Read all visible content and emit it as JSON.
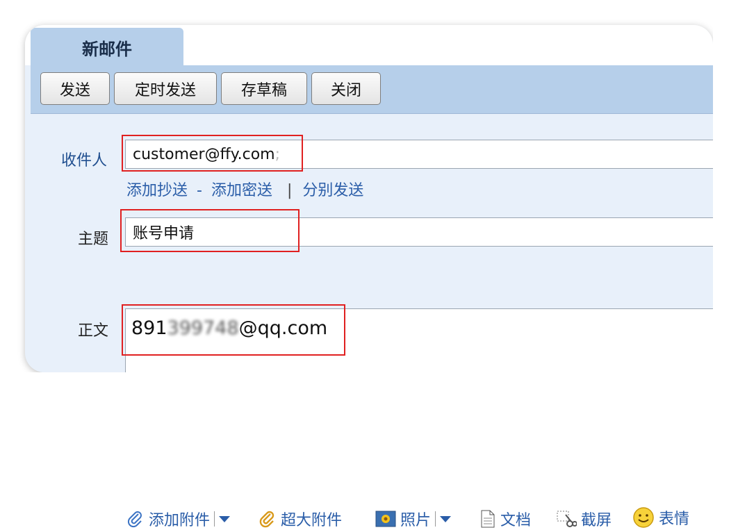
{
  "tab": {
    "title": "新邮件"
  },
  "toolbar": {
    "send_label": "发送",
    "scheduled_send_label": "定时发送",
    "save_draft_label": "存草稿",
    "close_label": "关闭"
  },
  "recipient": {
    "label": "收件人",
    "value": "customer@ffy.com",
    "separator": ";"
  },
  "recipient_links": {
    "add_cc": "添加抄送",
    "dash": "-",
    "add_bcc": "添加密送",
    "divider": "|",
    "separate_send": "分别发送"
  },
  "subject": {
    "label": "主题",
    "value": "账号申请"
  },
  "attachments": {
    "add_attachment": "添加附件",
    "large_attachment": "超大附件",
    "photo": "照片",
    "document": "文档",
    "screenshot": "截屏",
    "emoji": "表情"
  },
  "body": {
    "label": "正文",
    "text_prefix": "891",
    "text_blurred": "399748",
    "text_suffix": "@qq.com"
  },
  "colors": {
    "accent": "#b6cfea",
    "link": "#2a5da8",
    "highlight": "#e02020"
  }
}
